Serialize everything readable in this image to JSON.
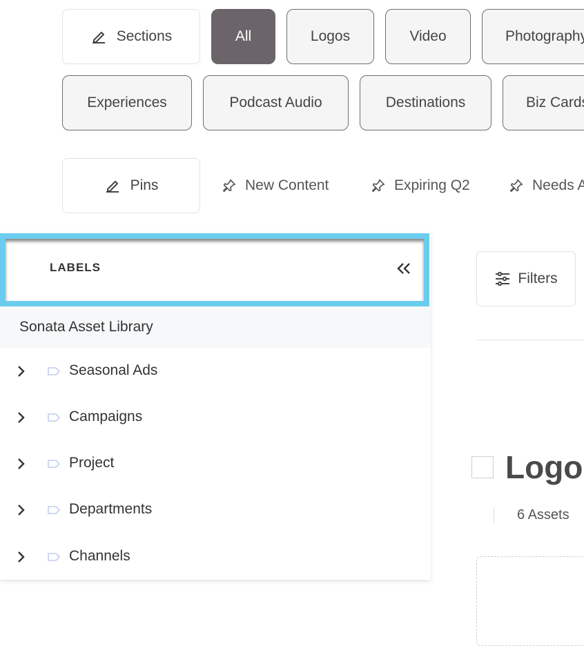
{
  "sections": {
    "edit_label": "Sections",
    "chips": [
      {
        "label": "All",
        "active": true
      },
      {
        "label": "Logos"
      },
      {
        "label": "Video"
      },
      {
        "label": "Photography"
      },
      {
        "label": "Experiences"
      },
      {
        "label": "Podcast Audio"
      },
      {
        "label": "Destinations"
      },
      {
        "label": "Biz Cards"
      }
    ]
  },
  "pins": {
    "edit_label": "Pins",
    "items": [
      {
        "label": "New Content",
        "icon": "pin-icon"
      },
      {
        "label": "Expiring Q2",
        "icon": "pin-icon"
      },
      {
        "label": "Needs Approval",
        "icon": "pin-icon"
      }
    ]
  },
  "labels_panel": {
    "title": "LABELS",
    "collapse_icon": "double-chevron-left-icon",
    "highlight_color": "#6bcdee",
    "library": "Sonata Asset Library",
    "items": [
      {
        "label": "Seasonal Ads"
      },
      {
        "label": "Campaigns"
      },
      {
        "label": "Project"
      },
      {
        "label": "Departments"
      },
      {
        "label": "Channels"
      }
    ]
  },
  "toolbar": {
    "filters_label": "Filters"
  },
  "section": {
    "title": "Logos",
    "asset_count": "6 Assets"
  },
  "colors": {
    "active_chip": "#6b6569",
    "label_tag": "#c9d3f0"
  }
}
